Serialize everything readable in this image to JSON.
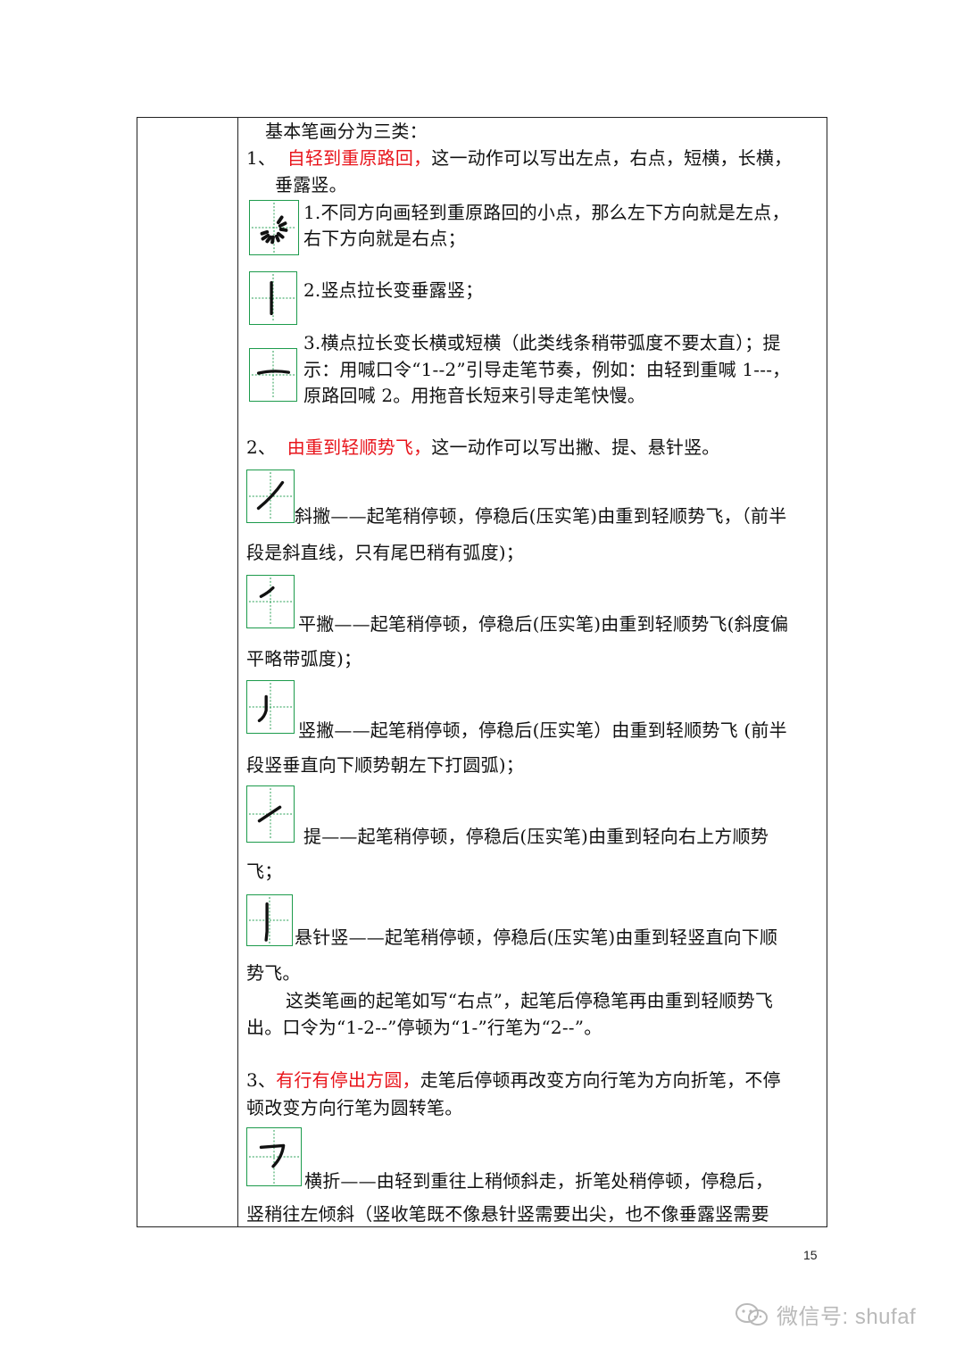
{
  "content": {
    "intro": "基本笔画分为三类：",
    "s1_num": "1、",
    "s1_red": "自轻到重原路回，",
    "s1_rest": "这一动作可以写出左点，右点，短横，长横，",
    "s1_rest2": "垂露竖。",
    "i1_l1": "1.不同方向画轻到重原路回的小点，那么左下方向就是左点，",
    "i1_l2": "右下方向就是右点；",
    "i2_l1": "2.竖点拉长变垂露竖；",
    "i3_l1": "3.横点拉长变长横或短横（此类线条稍带弧度不要太直）；提",
    "i3_l2": "示：用喊口令“1--2”引导走笔节奏，例如：由轻到重喊 1---，",
    "i3_l3": "原路回喊 2。用拖音长短来引导走笔快慢。",
    "s2_num": "2、",
    "s2_red": "由重到轻顺势飞，",
    "s2_rest": "这一动作可以写出撇、提、悬针竖。",
    "xiepie_l1": "斜撇——起笔稍停顿，停稳后(压实笔)由重到轻顺势飞，（前半",
    "xiepie_l2": "段是斜直线，只有尾巴稍有弧度)；",
    "pingpie_l1": "平撇——起笔稍停顿，停稳后(压实笔)由重到轻顺势飞(斜度偏",
    "pingpie_l2": "平略带弧度)；",
    "shupie_l1": "竖撇——起笔稍停顿，停稳后(压实笔）由重到轻顺势飞 (前半",
    "shupie_l2": "段竖垂直向下顺势朝左下打圆弧)；",
    "ti_l1": "提——起笔稍停顿，停稳后(压实笔)由重到轻向右上方顺势",
    "ti_l2": "飞；",
    "xuanzhen_l1": "悬针竖——起笔稍停顿，停稳后(压实笔)由重到轻竖直向下顺",
    "xuanzhen_l2": "势飞。",
    "note_l1": "这类笔画的起笔如写“右点”，起笔后停稳笔再由重到轻顺势飞",
    "note_l2": "出。口令为“1-2--”停顿为“1-”行笔为“2--”。",
    "s3_num": "3、",
    "s3_red": "有行有停出方圆，",
    "s3_rest": "走笔后停顿再改变方向行笔为方向折笔，不停",
    "s3_rest2": "顿改变方向行笔为圆转笔。",
    "hengzhe_l1": "横折——由轻到重往上稍倾斜走，折笔处稍停顿，停稳后，",
    "hengzhe_l2": "竖稍往左倾斜（竖收笔既不像悬针竖需要出尖，也不像垂露竖需要"
  },
  "page_number": "15",
  "watermark": "微信号: shufaf",
  "colors": {
    "accent_red": "#e8141b",
    "box_green": "#1d9b4c"
  },
  "icons": [
    "dots-stroke-icon",
    "vertical-stroke-icon",
    "horizontal-stroke-icon",
    "slant-pie-icon",
    "flat-pie-icon",
    "vertical-pie-icon",
    "ti-stroke-icon",
    "needle-vertical-icon",
    "heng-zhe-icon",
    "wechat-icon"
  ]
}
